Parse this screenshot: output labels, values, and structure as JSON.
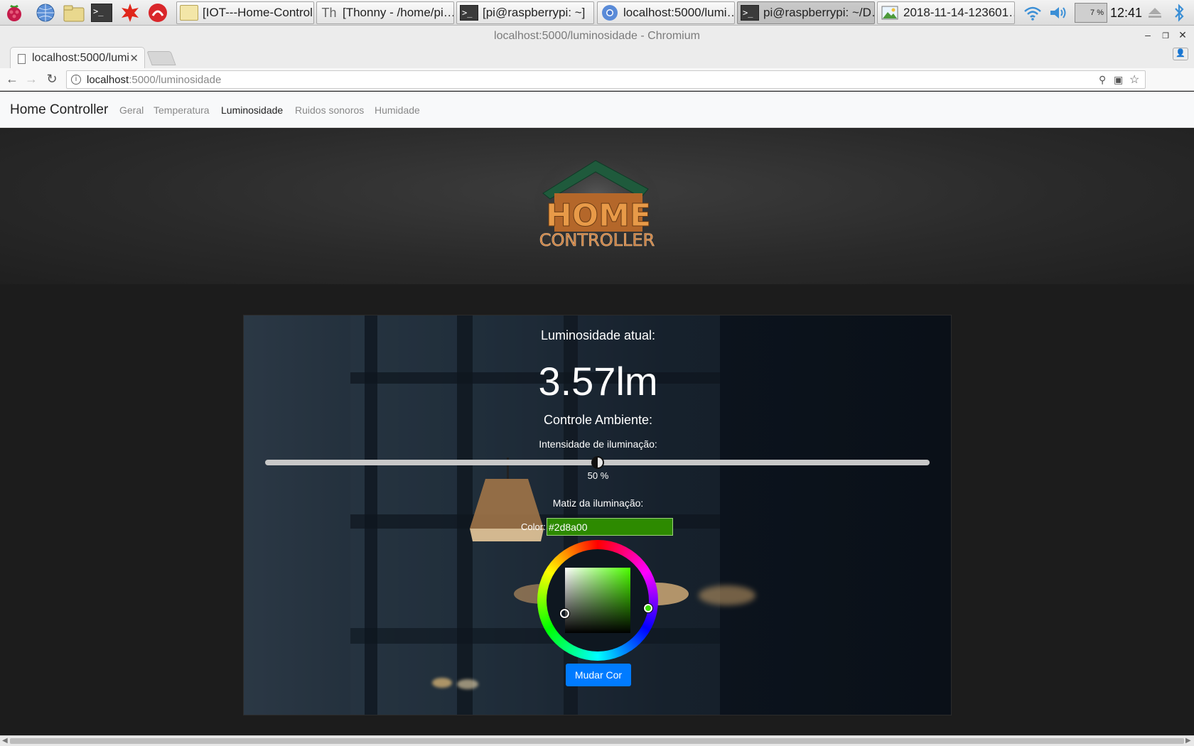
{
  "taskbar": {
    "launchers": [
      "raspberry-menu",
      "web-browser",
      "file-manager",
      "terminal",
      "mathematica",
      "wolfram"
    ],
    "tasks": [
      {
        "label": "[IOT---Home-Controll…",
        "icon": "folder-icon"
      },
      {
        "label": "[Thonny  -  /home/pi…",
        "icon": "thonny-icon"
      },
      {
        "label": "[pi@raspberrypi: ~]",
        "icon": "terminal-icon"
      },
      {
        "label": "localhost:5000/lumi…",
        "icon": "chromium-icon"
      },
      {
        "label": "pi@raspberrypi: ~/D…",
        "icon": "terminal-icon"
      },
      {
        "label": "2018-11-14-123601…",
        "icon": "image-icon"
      }
    ],
    "cpu": "7 %",
    "clock": "12:41"
  },
  "browser": {
    "window_title": "localhost:5000/luminosidade - Chromium",
    "tab_title": "localhost:5000/lumi",
    "url_host": "localhost",
    "url_path": ":5000/luminosidade"
  },
  "site": {
    "brand": "Home Controller",
    "nav": [
      "Geral",
      "Temperatura",
      "Luminosidade",
      "Ruidos sonoros",
      "Humidade"
    ],
    "active_nav": "Luminosidade",
    "logo_top": "HOME",
    "logo_bottom": "CONTROLLER"
  },
  "panel": {
    "current_label": "Luminosidade atual:",
    "current_value": "3.57lm",
    "ambient_label": "Controle Ambiente:",
    "intensity_label": "Intensidade de iluminação:",
    "intensity_value": 50,
    "intensity_text": "50 %",
    "hue_label": "Matiz da iluminação:",
    "color_label": "Color:",
    "color_value": "#2d8a00",
    "button_label": "Mudar Cor"
  },
  "colors": {
    "accent": "#007bff",
    "selected_color": "#2d8a00"
  }
}
